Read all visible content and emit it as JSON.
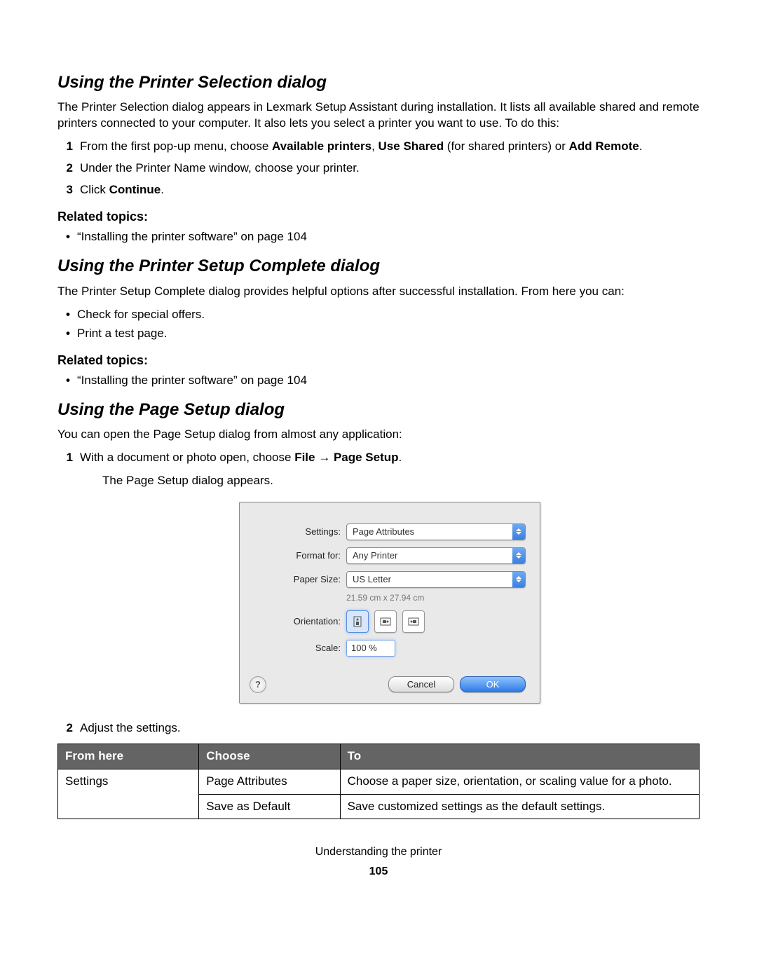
{
  "section1": {
    "heading": "Using the Printer Selection dialog",
    "intro": "The Printer Selection dialog appears in Lexmark Setup Assistant during installation. It lists all available shared and remote printers connected to your computer. It also lets you select a printer you want to use. To do this:",
    "step1_pre": "From the first pop-up menu, choose ",
    "step1_b1": "Available printers",
    "step1_mid1": ", ",
    "step1_b2": "Use Shared",
    "step1_mid2": " (for shared printers) or ",
    "step1_b3": "Add Remote",
    "step1_end": ".",
    "step2": "Under the Printer Name window, choose your printer.",
    "step3_pre": "Click ",
    "step3_b": "Continue",
    "step3_end": ".",
    "related_h": "Related topics:",
    "related_item": "“Installing the printer software” on page 104"
  },
  "section2": {
    "heading": "Using the Printer Setup Complete dialog",
    "intro": "The Printer Setup Complete dialog provides helpful options after successful installation. From here you can:",
    "b1": "Check for special offers.",
    "b2": "Print a test page.",
    "related_h": "Related topics:",
    "related_item": "“Installing the printer software” on page 104"
  },
  "section3": {
    "heading": "Using the Page Setup dialog",
    "intro": "You can open the Page Setup dialog from almost any application:",
    "step1_pre": "With a document or photo open, choose ",
    "step1_b1": "File",
    "step1_arrow": " → ",
    "step1_b2": "Page Setup",
    "step1_end": ".",
    "step1_sub": "The Page Setup dialog appears.",
    "step2": "Adjust the settings."
  },
  "dialog": {
    "settings_label": "Settings:",
    "settings_value": "Page Attributes",
    "format_label": "Format for:",
    "format_value": "Any Printer",
    "paper_label": "Paper Size:",
    "paper_value": "US Letter",
    "paper_dim": "21.59 cm x 27.94 cm",
    "orientation_label": "Orientation:",
    "scale_label": "Scale:",
    "scale_value": "100 %",
    "help": "?",
    "cancel": "Cancel",
    "ok": "OK"
  },
  "table": {
    "h1": "From here",
    "h2": "Choose",
    "h3": "To",
    "r1c1": "Settings",
    "r1c2": "Page Attributes",
    "r1c3": "Choose a paper size, orientation, or scaling value for a photo.",
    "r2c2": "Save as Default",
    "r2c3": "Save customized settings as the default settings."
  },
  "footer": {
    "chapter": "Understanding the printer",
    "page": "105"
  }
}
